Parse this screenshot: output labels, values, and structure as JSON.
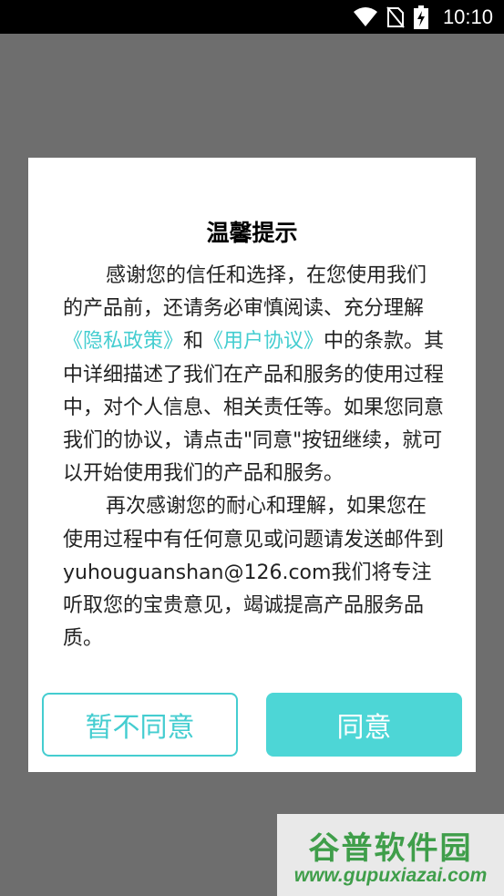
{
  "status_bar": {
    "time": "10:10",
    "icons": [
      "wifi-icon",
      "no-sim-icon",
      "battery-charging-icon"
    ]
  },
  "dialog": {
    "title": "温馨提示",
    "paragraph1": {
      "text_before": "感谢您的信任和选择，在您使用我们的产品前，还请务必审慎阅读、充分理解",
      "privacy_link": "《隐私政策》",
      "and": "和",
      "agreement_link": "《用户协议》",
      "text_after": "中的条款。其中详细描述了我们在产品和服务的使用过程中，对个人信息、相关责任等。如果您同意我们的协议，请点击\"同意\"按钮继续，就可以开始使用我们的产品和服务。"
    },
    "paragraph2": "再次感谢您的耐心和理解，如果您在使用过程中有任何意见或问题请发送邮件到yuhouguanshan@126.com我们将专注听取您的宝贵意见，竭诚提高产品服务品质。",
    "decline_label": "暂不同意",
    "agree_label": "同意"
  },
  "watermark": {
    "brand": "谷普软件园",
    "url": "www.gupuxiazai.com"
  },
  "colors": {
    "accent": "#44cdd0",
    "agree_button": "#4dd6d6",
    "overlay": "#6e6e6e",
    "watermark": "#3f9e4a"
  }
}
